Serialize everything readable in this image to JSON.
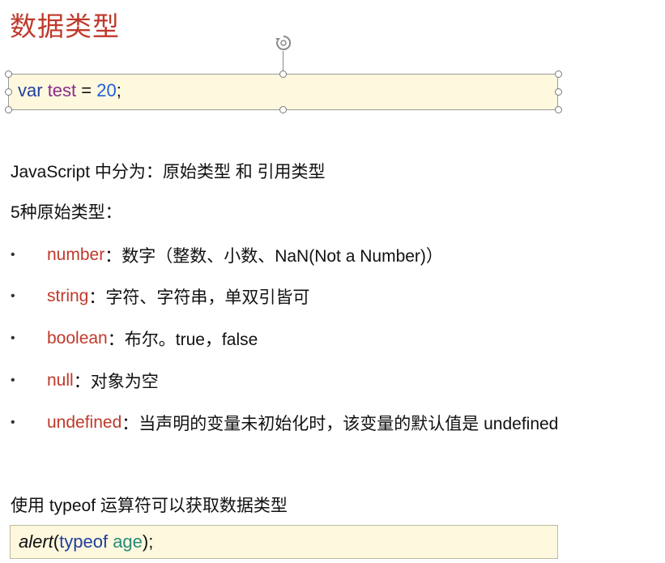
{
  "slide": {
    "title": "数据类型",
    "code1": {
      "kw": "var",
      "name": "test",
      "op": "=",
      "value": "20",
      "end": ";"
    },
    "intro": "JavaScript 中分为：原始类型 和 引用类型",
    "subheading": "5种原始类型：",
    "bullet_symbol": "•",
    "bullets": [
      {
        "key": "number",
        "text": "：数字（整数、小数、NaN(Not a Number)）"
      },
      {
        "key": "string",
        "text": "：字符、字符串，单双引皆可"
      },
      {
        "key": "boolean",
        "text": "：布尔。true，false"
      },
      {
        "key": "null",
        "text": "：对象为空"
      },
      {
        "key": "undefined",
        "text": "：当声明的变量未初始化时，该变量的默认值是 undefined"
      }
    ],
    "typeof_line": "使用 typeof 运算符可以获取数据类型",
    "code2": {
      "fn": "alert",
      "open": "(",
      "kw": "typeof",
      "ident": "age",
      "close": ");"
    }
  },
  "colors": {
    "title": "#c0392b",
    "keyword": "#1f3f9e",
    "code_bg": "#fdf8de"
  },
  "icons": {
    "rotate": "rotate-handle-icon"
  }
}
